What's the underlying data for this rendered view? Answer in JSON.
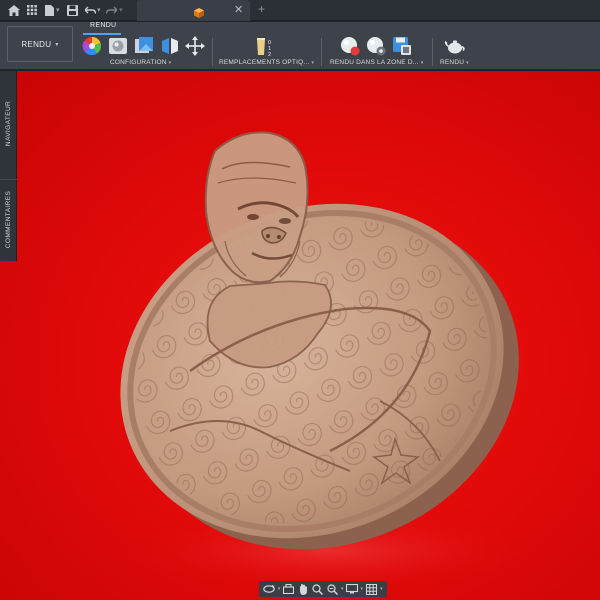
{
  "ribbon": {
    "workspace_label": "RENDU",
    "active_tab": "RENDU",
    "groups": {
      "configuration": "CONFIGURATION",
      "remplacements": "REMPLACEMENTS OPTIQ...",
      "rendu_zone": "RENDU DANS LA ZONE D...",
      "rendu": "RENDU"
    }
  },
  "side_panel": {
    "navigator": "NAVIGATEUR",
    "comments": "COMMENTAIRES"
  },
  "colors": {
    "accent": "#4aa3ff",
    "viewport_background": "#e20a0a",
    "model_color": "#c49a80"
  },
  "icons": {
    "topbar": [
      "home-icon",
      "grid-icon",
      "file-icon",
      "save-icon",
      "undo-icon",
      "redo-icon"
    ],
    "tab": [
      "cube-icon",
      "close-icon",
      "plus-icon"
    ],
    "ribbon": [
      "color-wheel-icon",
      "scene-settings-icon",
      "texture-map-icon",
      "appearance-icon",
      "move-icon",
      "decal-counter-icon",
      "render-preview-icon",
      "render-settings-icon",
      "render-save-icon",
      "teapot-icon"
    ],
    "navbar": [
      "orbit-icon",
      "look-at-icon",
      "pan-icon",
      "zoom-window-icon",
      "zoom-icon",
      "display-settings-icon",
      "grid-settings-icon"
    ]
  }
}
